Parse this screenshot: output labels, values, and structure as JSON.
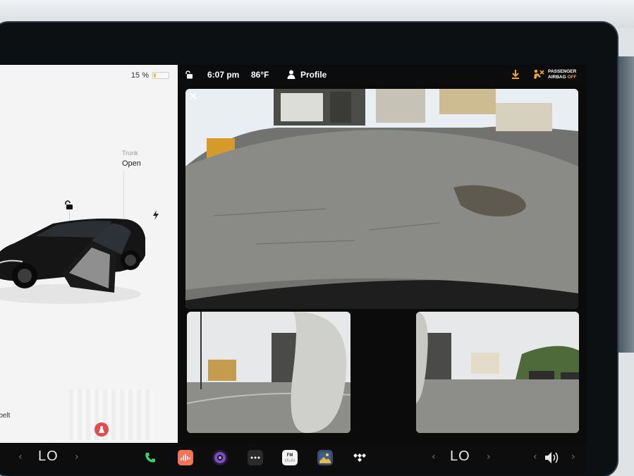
{
  "car_panel": {
    "battery_text": "15 %",
    "battery_level": 0.15,
    "trunk_label": "Trunk",
    "trunk_value": "Open",
    "seatbelt_text": "atbelt"
  },
  "status_bar": {
    "time": "6:07 pm",
    "temperature": "86°F",
    "profile_label": "Profile",
    "airbag_line1": "PASSENGER",
    "airbag_line2": "AIRBAG",
    "airbag_state": "OFF"
  },
  "dock": {
    "left_temp": "LO",
    "right_temp": "LO",
    "apps": [
      "phone-icon",
      "music-icon",
      "camera-icon",
      "more-icon",
      "radio-icon",
      "photos-icon",
      "tidal-icon"
    ],
    "radio_label": "FM"
  },
  "colors": {
    "accent_orange": "#f0a23a",
    "phone_green": "#3ccf6e",
    "warning_red": "#e24c4c"
  }
}
